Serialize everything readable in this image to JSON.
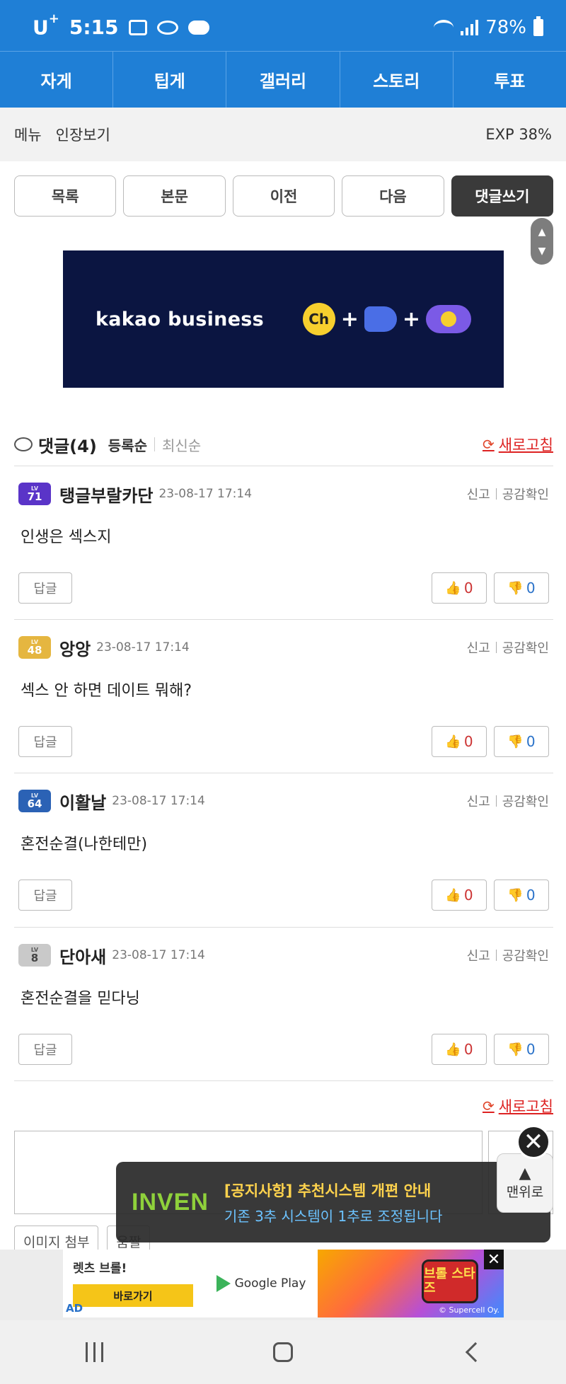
{
  "status_bar": {
    "carrier": "U",
    "carrier_sup": "+",
    "time": "5:15",
    "battery": "78%"
  },
  "top_nav": [
    "자게",
    "팁게",
    "갤러리",
    "스토리",
    "투표"
  ],
  "sub_bar": {
    "menu": "메뉴",
    "inventory": "인장보기",
    "exp": "EXP 38%"
  },
  "actions": {
    "list": "목록",
    "body": "본문",
    "prev": "이전",
    "next": "다음",
    "write_comment": "댓글쓰기"
  },
  "ad_banner": {
    "brand": "kakao business",
    "ch_label": "Ch",
    "plus": "+"
  },
  "comments_header": {
    "title": "댓글(4)",
    "sort_registered": "등록순",
    "sort_latest": "최신순",
    "refresh": "새로고침"
  },
  "comments": [
    {
      "level": "71",
      "lv_label": "LV",
      "nick": "탱글부랄카단",
      "date": "23-08-17 17:14",
      "report": "신고",
      "empathy": "공감확인",
      "body": "인생은 섹스지",
      "reply": "답글",
      "up": "0",
      "down": "0"
    },
    {
      "level": "48",
      "lv_label": "LV",
      "nick": "앙앙",
      "date": "23-08-17 17:14",
      "report": "신고",
      "empathy": "공감확인",
      "body": "섹스 안 하면 데이트 뭐해?",
      "reply": "답글",
      "up": "0",
      "down": "0"
    },
    {
      "level": "64",
      "lv_label": "LV",
      "nick": "이활날",
      "date": "23-08-17 17:14",
      "report": "신고",
      "empathy": "공감확인",
      "body": "혼전순결(나한테만)",
      "reply": "답글",
      "up": "0",
      "down": "0"
    },
    {
      "level": "8",
      "lv_label": "LV",
      "nick": "단아새",
      "date": "23-08-17 17:14",
      "report": "신고",
      "empathy": "공감확인",
      "body": "혼전순결을 믿다닝",
      "reply": "답글",
      "up": "0",
      "down": "0"
    }
  ],
  "bottom": {
    "refresh": "새로고침",
    "attach_image": "이미지 첨부",
    "short_video": "움짤",
    "to_top": "맨위로"
  },
  "toast": {
    "logo": "INVEN",
    "line1": "[공지사항] 추천시스템 개편 안내",
    "line2": "기존 3추 시스템이 1추로 조정됩니다"
  },
  "bottom_ad": {
    "text": "렛츠 브롤!",
    "go": "바로가기",
    "ad_label": "AD",
    "store": "Google Play",
    "game": "브롤 스타즈",
    "copyright": "© Supercell Oy."
  },
  "colors": {
    "brand_blue": "#1f7fd6",
    "refresh_red": "#dd2222",
    "vote_up": "#cc3333",
    "vote_down": "#2a72c9"
  }
}
